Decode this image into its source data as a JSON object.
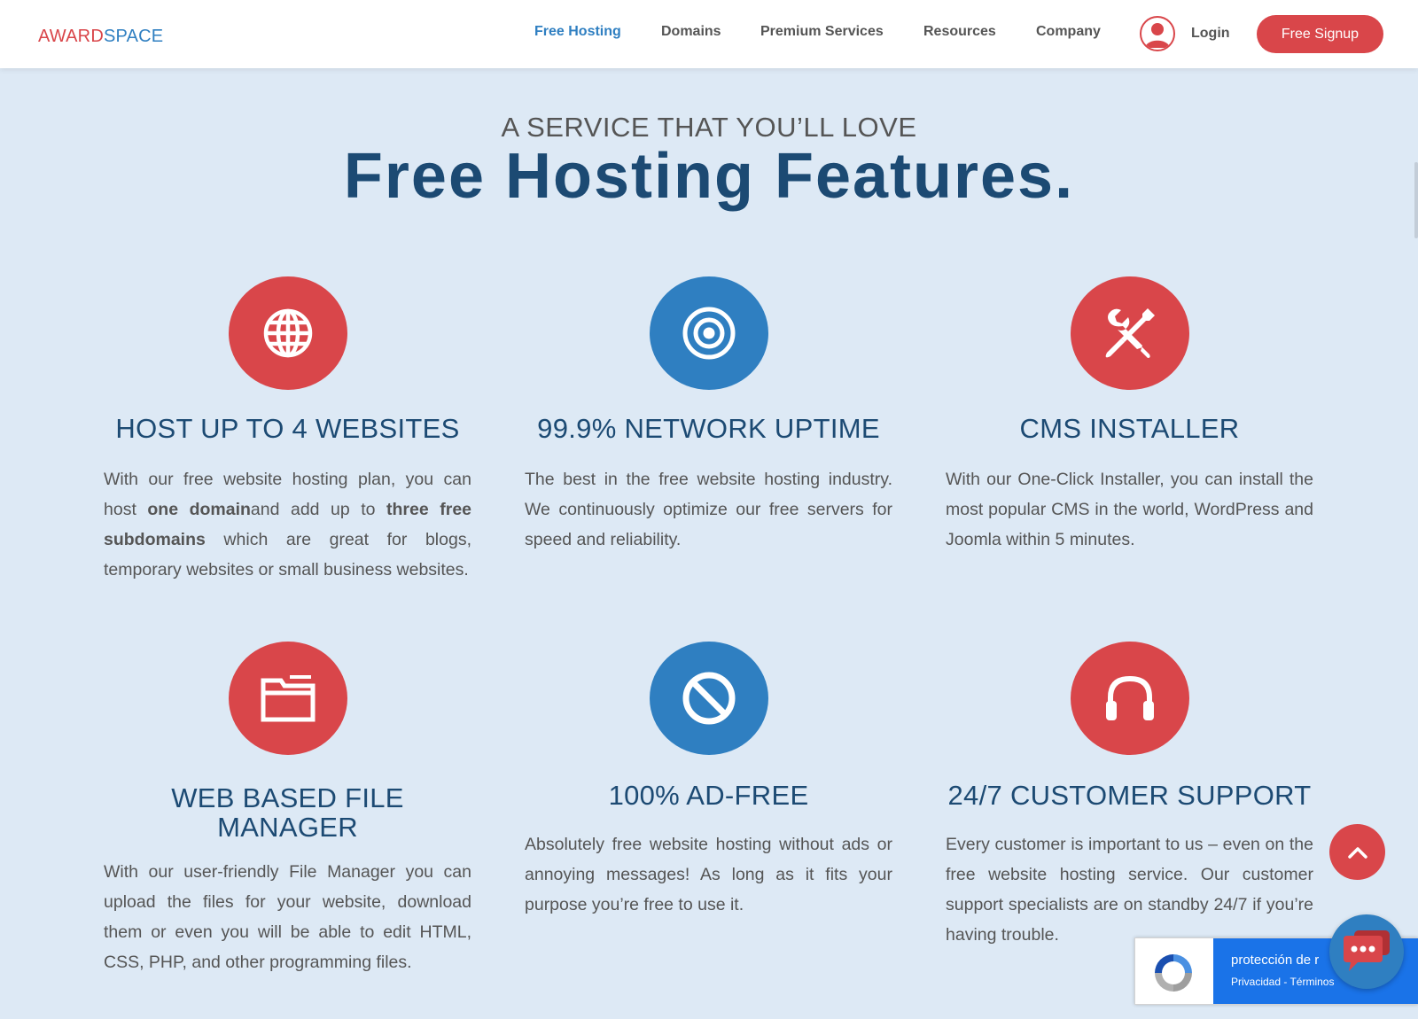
{
  "header": {
    "logo": {
      "part1": "AWARD",
      "part2": "SPACE"
    },
    "nav": [
      {
        "label": "Free Hosting",
        "active": true
      },
      {
        "label": "Domains",
        "active": false
      },
      {
        "label": "Premium Services",
        "active": false
      },
      {
        "label": "Resources",
        "active": false
      },
      {
        "label": "Company",
        "active": false
      }
    ],
    "login_label": "Login",
    "signup_label": "Free Signup"
  },
  "section": {
    "kicker": "A SERVICE THAT YOU’LL LOVE",
    "title": "Free Hosting Features."
  },
  "features": [
    {
      "icon": "globe-icon",
      "color": "red",
      "title": "HOST UP TO 4 WEBSITES",
      "desc_parts": [
        {
          "t": "With our free website hosting plan, you can host ",
          "b": false
        },
        {
          "t": "one domain",
          "b": true
        },
        {
          "t": "and add up to ",
          "b": false
        },
        {
          "t": "three free subdomains",
          "b": true
        },
        {
          "t": " which are great for blogs, temporary websites or small business websites.",
          "b": false
        }
      ]
    },
    {
      "icon": "target-icon",
      "color": "blue",
      "title": "99.9% NETWORK UPTIME",
      "desc": "The best in the free website hosting industry. We continuously optimize our free servers for speed and reliability."
    },
    {
      "icon": "tools-icon",
      "color": "red",
      "title": "CMS INSTALLER",
      "desc": "With our One-Click Installer, you can install the most popular CMS in the world, WordPress and Joomla within 5 minutes."
    },
    {
      "icon": "folder-icon",
      "color": "red",
      "title_line1": "WEB BASED FILE",
      "title_line2": "MANAGER",
      "desc": "With our user-friendly File Manager you can upload the files for your website, download them or even you will be able to edit HTML, CSS, PHP, and other programming files."
    },
    {
      "icon": "ban-icon",
      "color": "blue",
      "title": "100% AD-FREE",
      "desc": "Absolutely free website hosting without ads or annoying messages! As long as it fits your purpose you’re free to use it."
    },
    {
      "icon": "headphones-icon",
      "color": "red",
      "title": "24/7 CUSTOMER SUPPORT",
      "desc": "Every customer is important to us – even on the free website hosting service. Our customer support specialists are on standby 24/7 if you’re having trouble."
    }
  ],
  "recaptcha": {
    "title": "protección de r",
    "links": "Privacidad - Términos"
  },
  "colors": {
    "red": "#d9464a",
    "blue": "#2f7fc1",
    "navy": "#1c4a73",
    "background": "#dde9f5"
  }
}
